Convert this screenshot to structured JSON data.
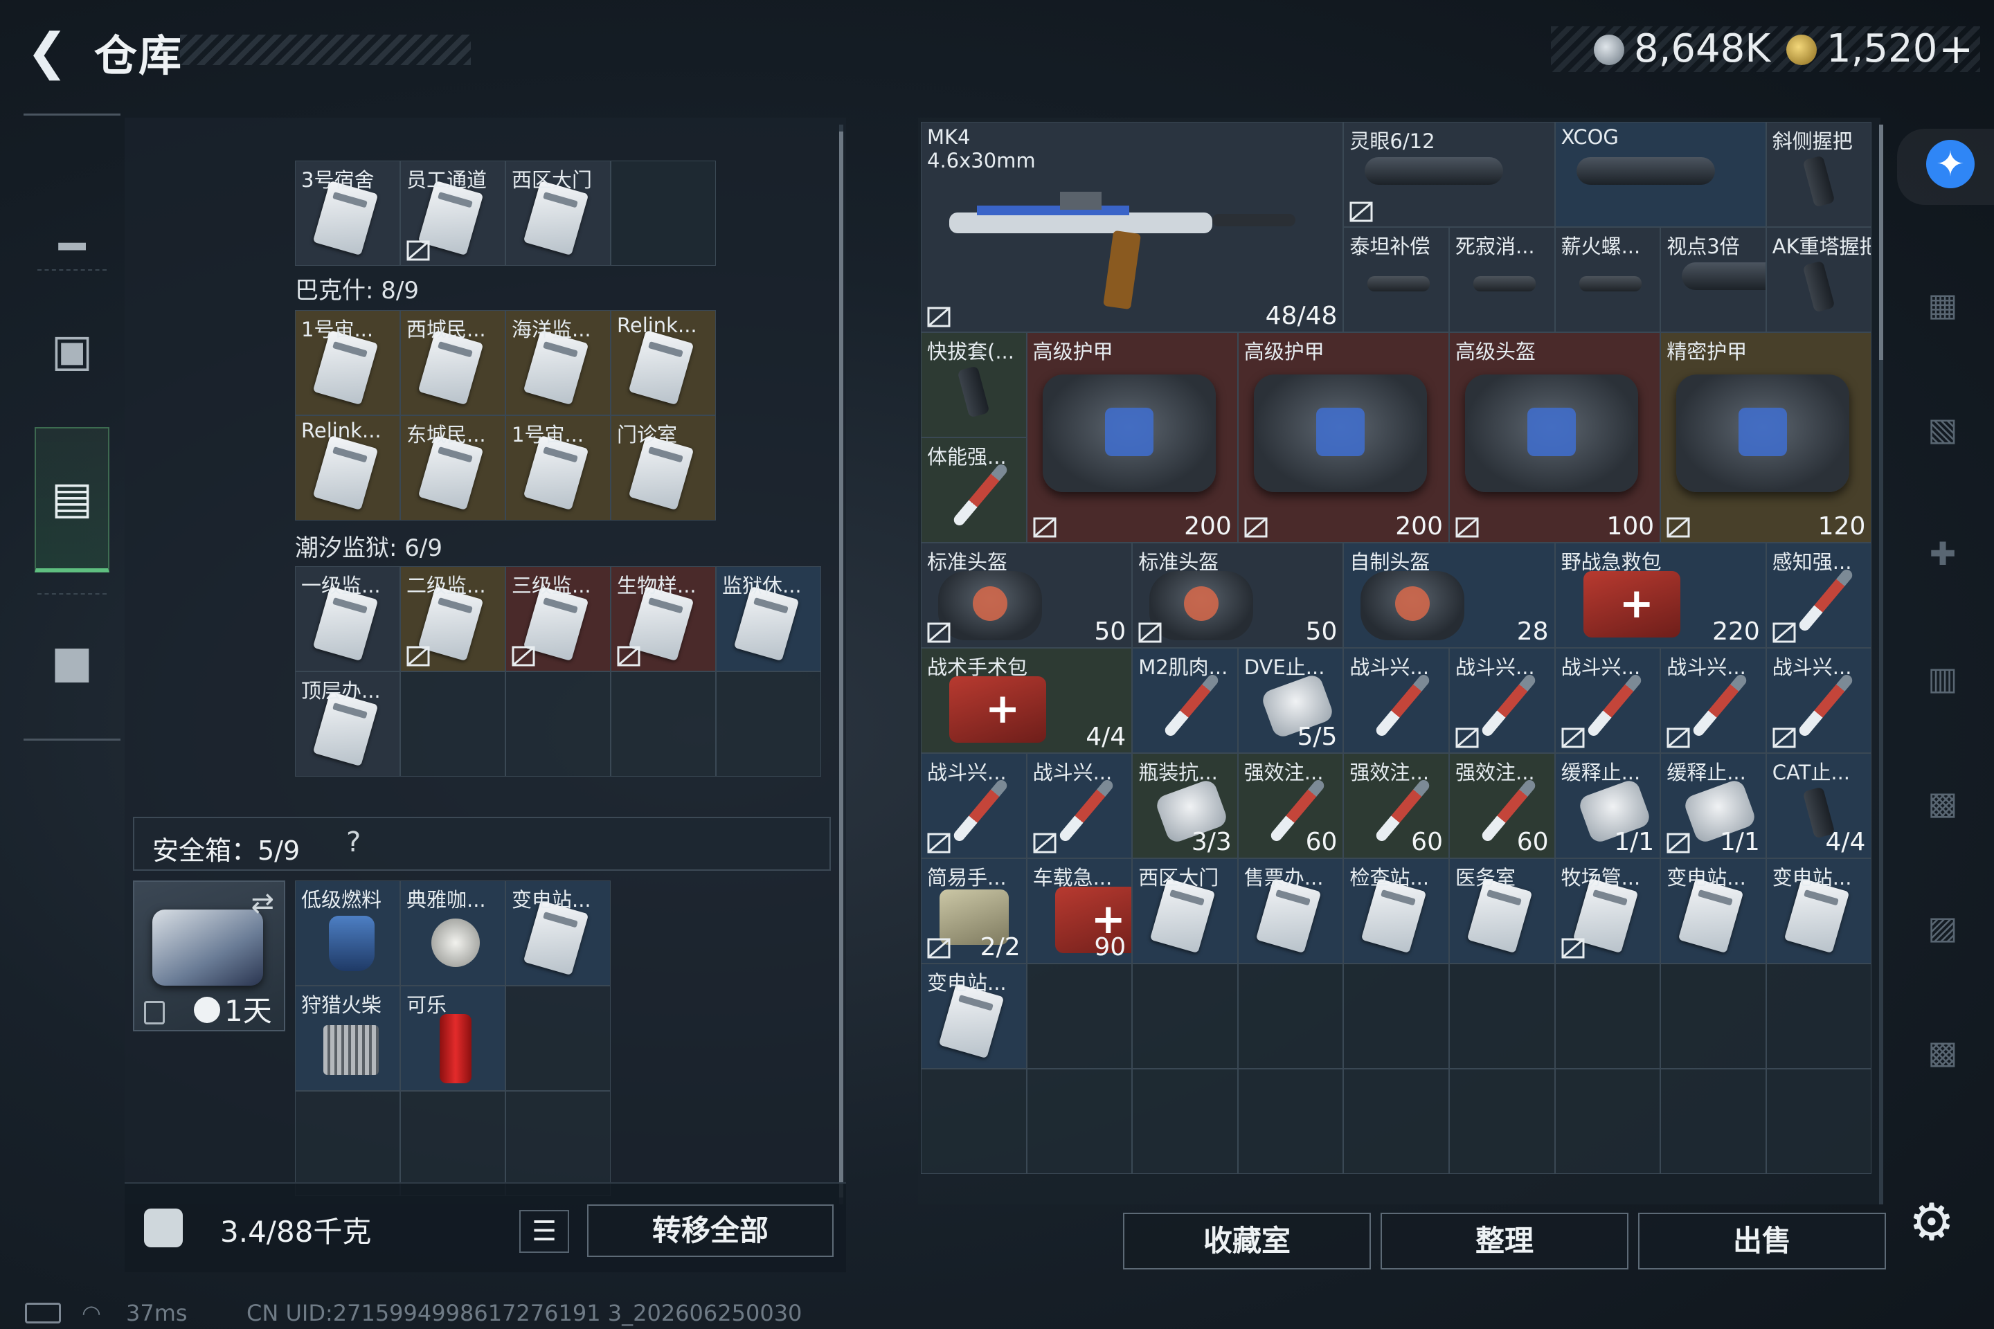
{
  "header": {
    "back_icon": "back-arrow-icon",
    "title": "仓库"
  },
  "currency": {
    "silver": "8,648K",
    "gold": "1,520",
    "add": "+",
    "silver_icon": "silver-coin-icon",
    "gold_icon": "gold-coin-icon"
  },
  "sidenav": [
    {
      "name": "weapon",
      "icon": "pistol-icon"
    },
    {
      "name": "backpack",
      "icon": "backpack-icon"
    },
    {
      "name": "warehouse",
      "icon": "locker-icon",
      "active": true
    },
    {
      "name": "briefcase",
      "icon": "briefcase-icon"
    }
  ],
  "left": {
    "top_row": [
      {
        "label": "3号宿舍",
        "kind": "keycard",
        "tier": 1
      },
      {
        "label": "员工通道",
        "kind": "keycard",
        "tier": 1,
        "nolink": true
      },
      {
        "label": "西区大门",
        "kind": "keycard",
        "tier": 1
      },
      {
        "label": "",
        "kind": "",
        "tier": 0
      }
    ],
    "bakeshi": {
      "title": "巴克什: 8/9",
      "items": [
        {
          "label": "1号宙...",
          "kind": "keycard",
          "tier": 5
        },
        {
          "label": "西城民...",
          "kind": "keycard",
          "tier": 5
        },
        {
          "label": "海洋监...",
          "kind": "keycard",
          "tier": 5
        },
        {
          "label": "Relink...",
          "kind": "keycard",
          "tier": 5
        },
        {
          "label": "Relink...",
          "kind": "keycard",
          "tier": 5
        },
        {
          "label": "东城民...",
          "kind": "keycard",
          "tier": 5
        },
        {
          "label": "1号宙...",
          "kind": "keycard",
          "tier": 5
        },
        {
          "label": "门诊室",
          "kind": "keycard",
          "tier": 5
        }
      ]
    },
    "chaoxi": {
      "title": "潮汐监狱: 6/9",
      "items": [
        {
          "label": "一级监...",
          "kind": "keycard",
          "tier": 1
        },
        {
          "label": "二级监...",
          "kind": "keycard",
          "tier": 5,
          "nolink": true
        },
        {
          "label": "三级监...",
          "kind": "keycard",
          "tier": 6,
          "nolink": true
        },
        {
          "label": "生物样...",
          "kind": "keycard",
          "tier": 6,
          "nolink": true
        },
        {
          "label": "监狱休...",
          "kind": "keycard",
          "tier": 3
        },
        {
          "label": "顶层办...",
          "kind": "keycard",
          "tier": 1
        }
      ]
    },
    "safe": {
      "title": "安全箱：5/9",
      "help": "?",
      "time": "1天",
      "swap_icon": "swap-icon",
      "items": [
        {
          "label": "低级燃料",
          "kind": "fuel",
          "tier": 3
        },
        {
          "label": "典雅咖...",
          "kind": "food",
          "tier": 3
        },
        {
          "label": "变电站...",
          "kind": "keycard",
          "tier": 3
        },
        {
          "label": "狩猎火柴",
          "kind": "matches",
          "tier": 3
        },
        {
          "label": "可乐",
          "kind": "can",
          "tier": 3
        }
      ]
    },
    "weight": "3.4/88千克",
    "list_icon": "list-icon",
    "transfer": "转移全部"
  },
  "right": {
    "weapon": {
      "label": "MK4",
      "caliber": "4.6x30mm",
      "ammo": "48/48"
    },
    "attachments_top": [
      {
        "label": "灵眼6/12",
        "kind": "scope",
        "tier": 1,
        "nolink": true
      },
      {
        "label": "XCOG",
        "kind": "scope",
        "tier": 3
      },
      {
        "label": "斜侧握把",
        "kind": "grip",
        "tier": 1
      }
    ],
    "attachments_row2": [
      {
        "label": "泰坦补偿",
        "kind": "muzzle",
        "tier": 1
      },
      {
        "label": "死寂消...",
        "kind": "muzzle",
        "tier": 1
      },
      {
        "label": "薪火螺...",
        "kind": "muzzle",
        "tier": 1
      },
      {
        "label": "视点3倍",
        "kind": "scope",
        "tier": 1
      },
      {
        "label": "AK重塔握把",
        "kind": "grip",
        "tier": 1
      }
    ],
    "armor_row": [
      {
        "label": "高级护甲",
        "value": "200",
        "tier": 6,
        "nolink": true
      },
      {
        "label": "高级护甲",
        "value": "200",
        "tier": 6,
        "nolink": true
      },
      {
        "label": "高级头盔",
        "value": "100",
        "tier": 6,
        "nolink": true
      },
      {
        "label": "精密护甲",
        "value": "120",
        "tier": 5,
        "nolink": true
      }
    ],
    "holster": {
      "label": "快拔套(...",
      "tier": 2
    },
    "stim": {
      "label": "体能强...",
      "tier": 2
    },
    "row_helmets": [
      {
        "label": "标准头盔",
        "value": "50",
        "kind": "helmet",
        "tier": 1,
        "nolink": true
      },
      {
        "label": "标准头盔",
        "value": "50",
        "kind": "helmet",
        "tier": 1,
        "nolink": true
      },
      {
        "label": "自制头盔",
        "value": "28",
        "kind": "helmet",
        "tier": 3
      },
      {
        "label": "野战急救包",
        "value": "220",
        "kind": "medkit",
        "tier": 3
      },
      {
        "label": "感知强...",
        "value": "",
        "kind": "syr",
        "tier": 3,
        "nolink": true
      }
    ],
    "row_med1": [
      {
        "label": "战术手术包",
        "value": "4/4",
        "kind": "medkit",
        "tier": 2,
        "wide": true
      },
      {
        "label": "M2肌肉...",
        "value": "",
        "kind": "syr",
        "tier": 3
      },
      {
        "label": "DVE止...",
        "value": "5/5",
        "kind": "capsule",
        "tier": 3
      },
      {
        "label": "战斗兴...",
        "value": "",
        "kind": "syr",
        "tier": 3
      },
      {
        "label": "战斗兴...",
        "value": "",
        "kind": "syr",
        "tier": 3,
        "nolink": true
      },
      {
        "label": "战斗兴...",
        "value": "",
        "kind": "syr",
        "tier": 3,
        "nolink": true
      },
      {
        "label": "战斗兴...",
        "value": "",
        "kind": "syr",
        "tier": 3,
        "nolink": true
      },
      {
        "label": "战斗兴...",
        "value": "",
        "kind": "syr",
        "tier": 3,
        "nolink": true
      }
    ],
    "row_med2": [
      {
        "label": "战斗兴...",
        "value": "",
        "kind": "syr",
        "tier": 3,
        "nolink": true
      },
      {
        "label": "战斗兴...",
        "value": "",
        "kind": "syr",
        "tier": 3,
        "nolink": true
      },
      {
        "label": "瓶装抗...",
        "value": "3/3",
        "kind": "capsule",
        "tier": 2
      },
      {
        "label": "强效注...",
        "value": "60",
        "kind": "syr",
        "tier": 2
      },
      {
        "label": "强效注...",
        "value": "60",
        "kind": "syr",
        "tier": 2
      },
      {
        "label": "强效注...",
        "value": "60",
        "kind": "syr",
        "tier": 2
      },
      {
        "label": "缓释止...",
        "value": "1/1",
        "kind": "capsule",
        "tier": 3
      },
      {
        "label": "缓释止...",
        "value": "1/1",
        "kind": "capsule",
        "tier": 3,
        "nolink": true
      },
      {
        "label": "CAT止...",
        "value": "4/4",
        "kind": "grip",
        "tier": 3
      }
    ],
    "row_misc": [
      {
        "label": "简易手...",
        "value": "2/2",
        "kind": "pouch",
        "tier": 3,
        "nolink": true
      },
      {
        "label": "车载急...",
        "value": "90",
        "kind": "medkit",
        "tier": 3
      },
      {
        "label": "西区大门",
        "value": "",
        "kind": "keycard",
        "tier": 3
      },
      {
        "label": "售票办...",
        "value": "",
        "kind": "keycard",
        "tier": 3
      },
      {
        "label": "检查站...",
        "value": "",
        "kind": "keycard",
        "tier": 3
      },
      {
        "label": "医务室",
        "value": "",
        "kind": "keycard",
        "tier": 3
      },
      {
        "label": "牧场管...",
        "value": "",
        "kind": "keycard",
        "tier": 3,
        "nolink": true
      },
      {
        "label": "变电站...",
        "value": "",
        "kind": "keycard",
        "tier": 3
      },
      {
        "label": "变电站...",
        "value": "",
        "kind": "keycard",
        "tier": 3
      }
    ],
    "row_last": [
      {
        "label": "变电站...",
        "value": "",
        "kind": "keycard",
        "tier": 3
      }
    ],
    "buttons": {
      "collection": "收藏室",
      "organize": "整理",
      "sell": "出售"
    }
  },
  "rightcol": {
    "accessibility_icon": "accessibility-icon",
    "icons": [
      "gtl-case-icon",
      "iv-box-icon",
      "iv-medkit-icon",
      "iv-crate-icon",
      "iv-vehicle-icon",
      "v-container-icon",
      "iv-truck-icon"
    ],
    "settings_icon": "settings-gear-icon"
  },
  "status": {
    "ping": "37ms",
    "uid": "CN UID:2715994998617276191 3_202606250030",
    "battery_icon": "battery-icon",
    "wifi_icon": "wifi-icon"
  },
  "colors": {
    "accent_green": "#5fbf80",
    "tier_gold": "#48402a",
    "tier_red": "#4a2a2a",
    "tier_blue": "#263a4f"
  }
}
